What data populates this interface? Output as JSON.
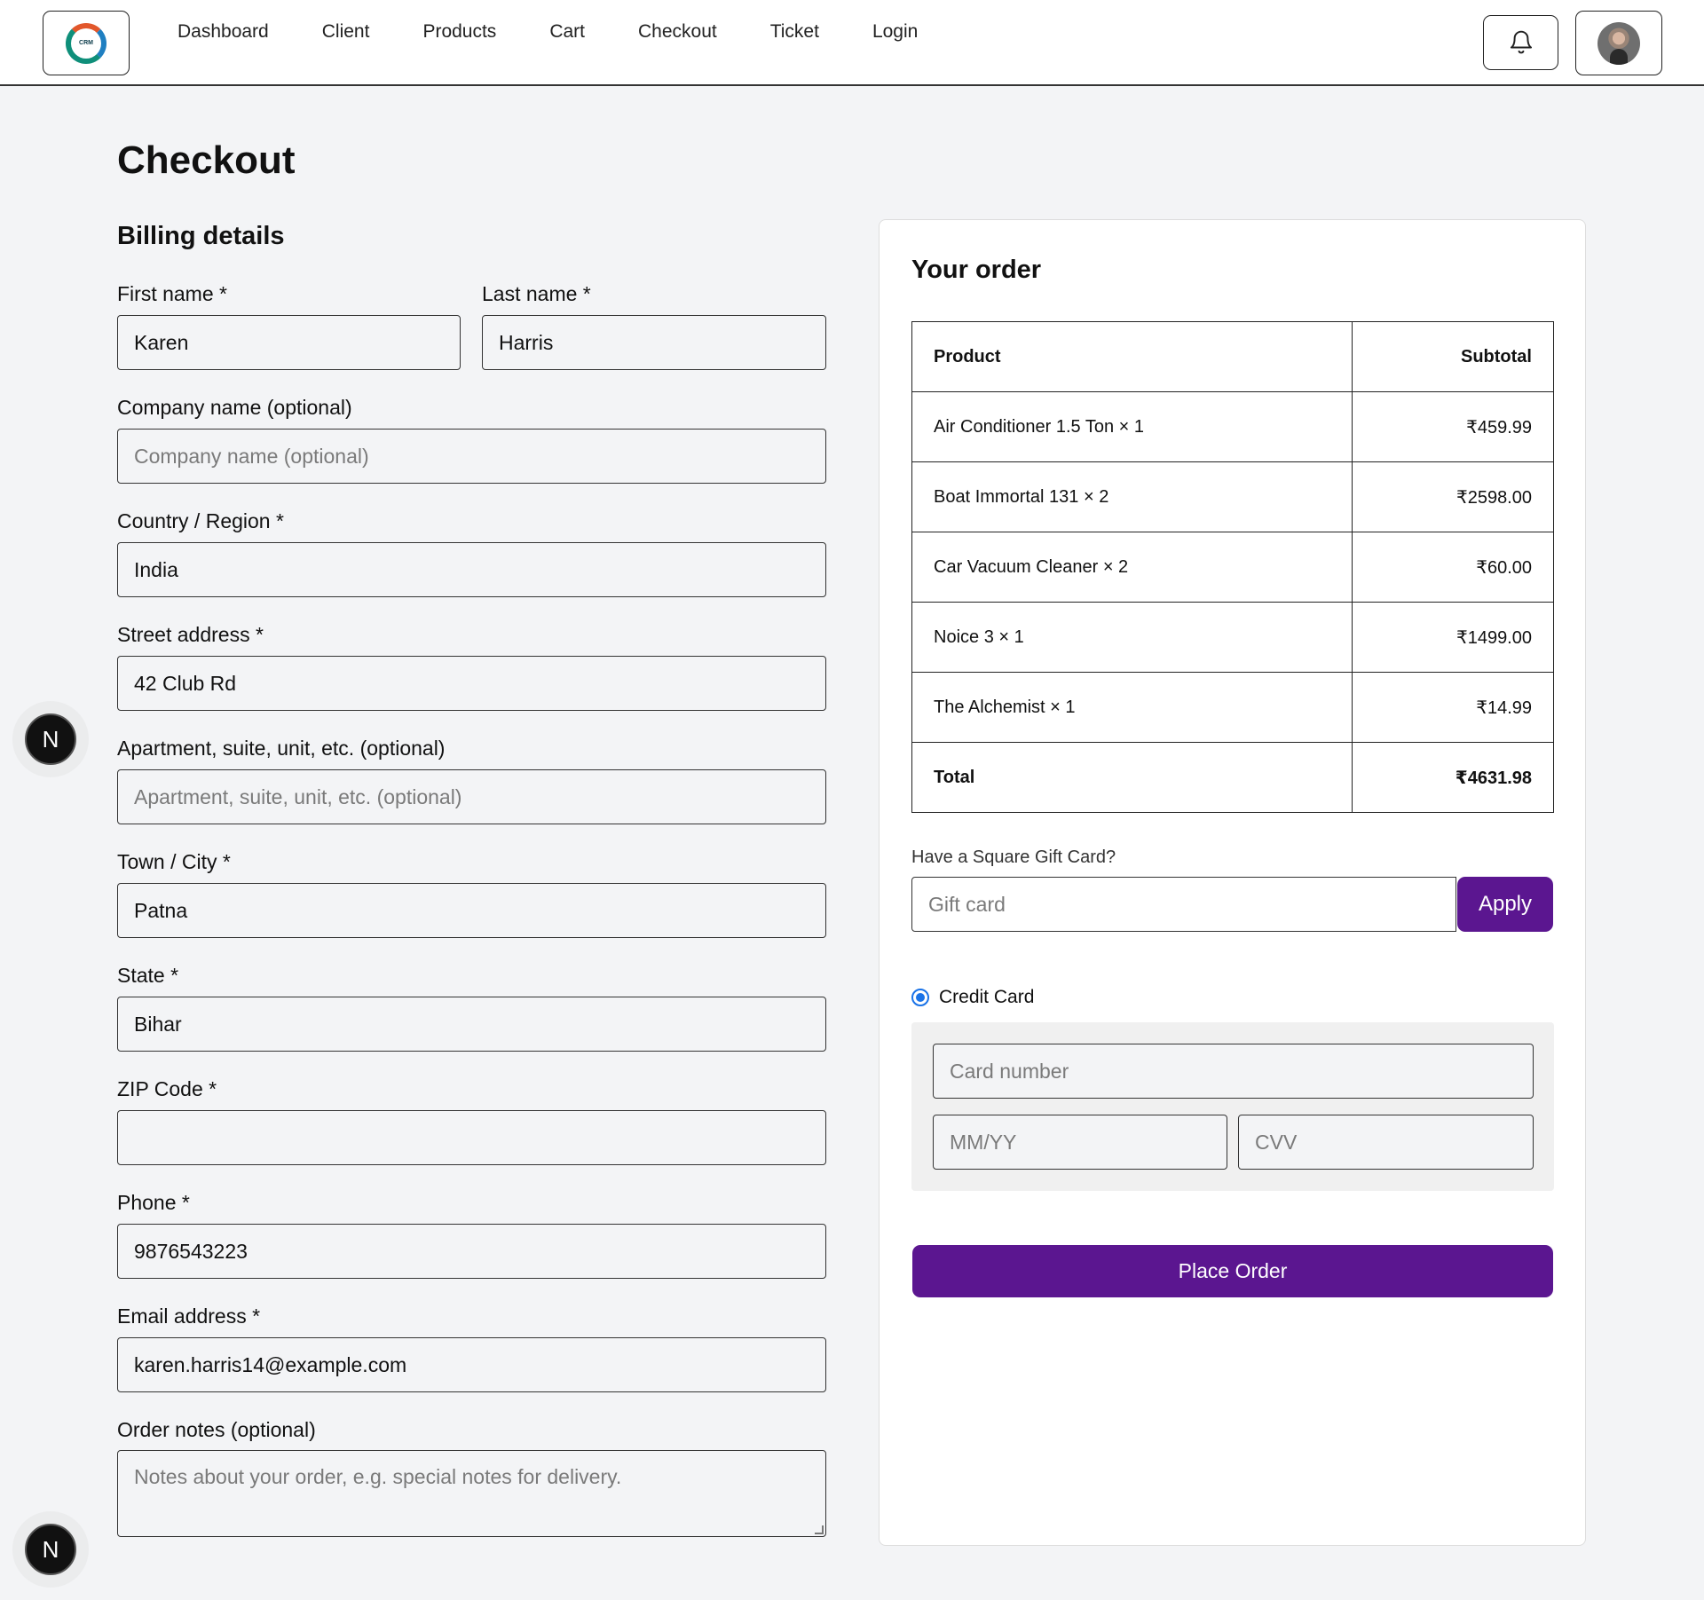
{
  "header": {
    "logo_text": "CRM",
    "nav": [
      "Dashboard",
      "Client",
      "Products",
      "Cart",
      "Checkout",
      "Ticket",
      "Login"
    ]
  },
  "page": {
    "title": "Checkout",
    "billing_title": "Billing details"
  },
  "billing": {
    "first_name": {
      "label": "First name *",
      "value": "Karen"
    },
    "last_name": {
      "label": "Last name *",
      "value": "Harris"
    },
    "company": {
      "label": "Company name (optional)",
      "placeholder": "Company name (optional)"
    },
    "country": {
      "label": "Country / Region *",
      "value": "India"
    },
    "street": {
      "label": "Street address *",
      "value": "42 Club Rd"
    },
    "apartment": {
      "label": "Apartment, suite, unit, etc. (optional)",
      "placeholder": "Apartment, suite, unit, etc. (optional)"
    },
    "city": {
      "label": "Town / City *",
      "value": "Patna"
    },
    "state": {
      "label": "State *",
      "value": "Bihar"
    },
    "zip": {
      "label": "ZIP Code *",
      "value": ""
    },
    "phone": {
      "label": "Phone *",
      "value": "9876543223"
    },
    "email": {
      "label": "Email address *",
      "value": "karen.harris14@example.com"
    },
    "notes": {
      "label": "Order notes (optional)",
      "placeholder": "Notes about your order, e.g. special notes for delivery."
    }
  },
  "order": {
    "title": "Your order",
    "headers": {
      "product": "Product",
      "subtotal": "Subtotal"
    },
    "items": [
      {
        "product": "Air Conditioner 1.5 Ton × 1",
        "subtotal": "₹459.99"
      },
      {
        "product": "Boat Immortal 131 × 2",
        "subtotal": "₹2598.00"
      },
      {
        "product": "Car Vacuum Cleaner × 2",
        "subtotal": "₹60.00"
      },
      {
        "product": "Noice 3 × 1",
        "subtotal": "₹1499.00"
      },
      {
        "product": "The Alchemist × 1",
        "subtotal": "₹14.99"
      }
    ],
    "total_label": "Total",
    "total_value": "₹4631.98"
  },
  "gift": {
    "label": "Have a Square Gift Card?",
    "placeholder": "Gift card",
    "apply": "Apply"
  },
  "payment": {
    "method": "Credit Card",
    "card_number_placeholder": "Card number",
    "expiry_placeholder": "MM/YY",
    "cvv_placeholder": "CVV",
    "place_order": "Place Order"
  },
  "badges": {
    "n": "N"
  },
  "colors": {
    "accent": "#5b1690",
    "radio": "#1a73e8"
  }
}
